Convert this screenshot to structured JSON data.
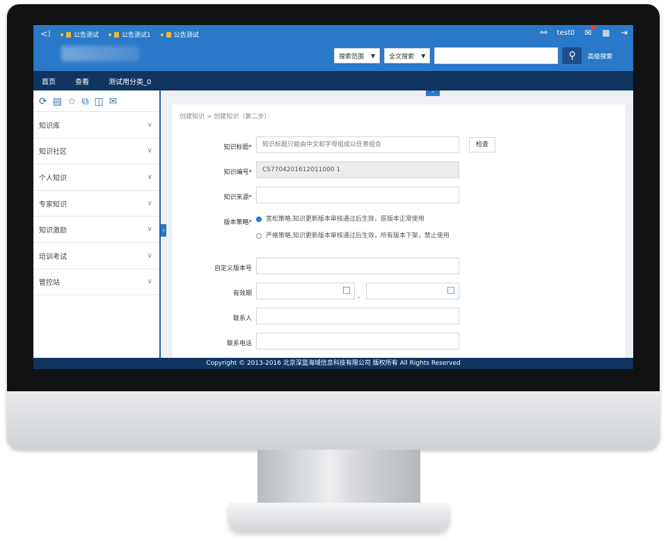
{
  "header": {
    "tabs": [
      "公告测试",
      "公告测试1",
      "公告测试"
    ],
    "user": "test0",
    "search_scope": "搜索范围",
    "search_mode": "全文搜索",
    "advanced_search": "高级搜索"
  },
  "nav": [
    "首页",
    "查看",
    "测试用分类_0"
  ],
  "sidebar": {
    "items": [
      "知识库",
      "知识社区",
      "个人知识",
      "专家知识",
      "知识激励",
      "培训考试",
      "管控站"
    ]
  },
  "form": {
    "breadcrumb": "创建知识 > 创建知识（第二步）",
    "title_label": "知识标题*",
    "title_value": "知识标题只能由中文和字母组成以任意组合",
    "check_button": "检查",
    "code_label": "知识编号*",
    "code_value": "CS7704201612011000 1",
    "source_label": "知识来源*",
    "version_label": "版本策略*",
    "version_option1": "宽松策略,知识更新版本审核通过后生效，原版本正常使用",
    "version_option2": "严格策略,知识更新版本审核通过后生效，所有版本下架，禁止使用",
    "custom_version_label": "自定义版本号",
    "validity_label": "有效期",
    "contact_label": "联系人",
    "phone_label": "联系电话"
  },
  "footer": "Copyright © 2013-2016 北京深蓝海域信息科技有限公司 版权所有 All Rights Reserved"
}
